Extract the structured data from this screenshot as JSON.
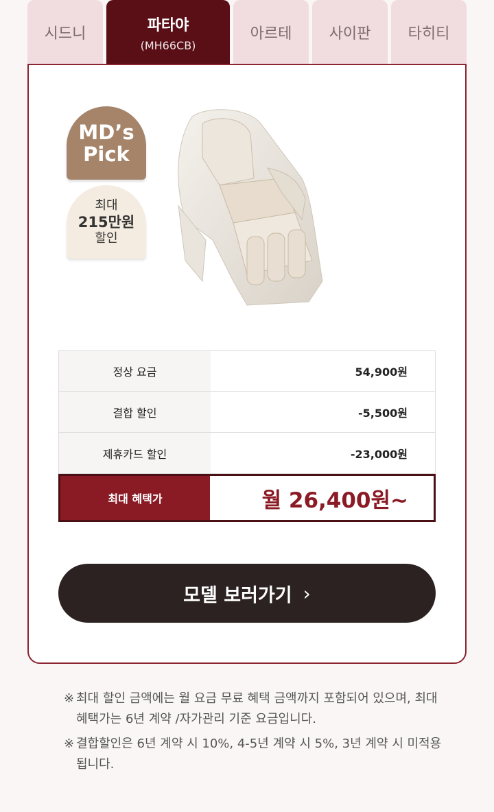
{
  "tabs": [
    {
      "name": "시드니",
      "model": "",
      "active": false
    },
    {
      "name": "파타야",
      "model": "(MH66CB)",
      "active": true
    },
    {
      "name": "아르테",
      "model": "",
      "active": false
    },
    {
      "name": "사이판",
      "model": "",
      "active": false
    },
    {
      "name": "타히티",
      "model": "",
      "active": false
    }
  ],
  "badges": {
    "md_line1": "MD’s",
    "md_line2": "Pick",
    "disc_line1": "최대",
    "disc_line2": "215만원",
    "disc_line3": "할인"
  },
  "prices": [
    {
      "label": "정상 요금",
      "value": "54,900원"
    },
    {
      "label": "결합 할인",
      "value": "-5,500원"
    },
    {
      "label": "제휴카드 할인",
      "value": "-23,000원"
    }
  ],
  "total": {
    "label": "최대 혜택가",
    "value": "월 26,400원~"
  },
  "cta": {
    "label": "모델 보러가기"
  },
  "notes": [
    {
      "mark": "※",
      "text": "최대 할인 금액에는 월 요금 무료 혜택 금액까지 포함되어 있으며, 최대 혜택가는 6년 계약 /자가관리 기준 요금입니다."
    },
    {
      "mark": "※",
      "text": "결합할인은 6년 계약 시 10%, 4-5년 계약 시 5%, 3년 계약 시 미적용됩니다."
    }
  ],
  "colors": {
    "accent": "#5a0e16",
    "price": "#8a1a24",
    "cta": "#2b2221"
  }
}
